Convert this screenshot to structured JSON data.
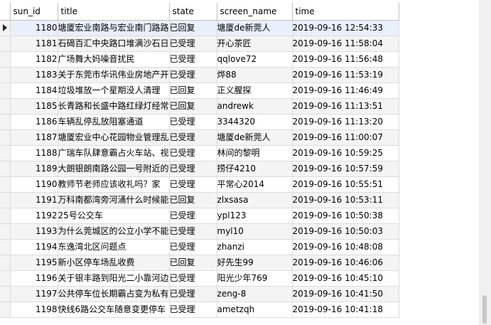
{
  "columns": [
    "sun_id",
    "title",
    "state",
    "screen_name",
    "time"
  ],
  "rows": [
    {
      "sun_id": "1180",
      "title": "塘厦宏业南路与宏业南门路路",
      "state": "已回复",
      "screen_name": "塘厦de新莞人",
      "time": "2019-09-16 12:54:33"
    },
    {
      "sun_id": "1181",
      "title": "石碣百汇中央路口堆满沙石日",
      "state": "已受理",
      "screen_name": "开心茶匠",
      "time": "2019-09-16 11:58:04"
    },
    {
      "sun_id": "1182",
      "title": "广场舞大妈噪音扰民",
      "state": "已受理",
      "screen_name": "qqlove72",
      "time": "2019-09-16 11:56:48"
    },
    {
      "sun_id": "1183",
      "title": "关于东莞市华讯伟业房地产开",
      "state": "已受理",
      "screen_name": "烨88",
      "time": "2019-09-16 11:53:19"
    },
    {
      "sun_id": "1184",
      "title": "垃圾堆放一个星期没人清理",
      "state": "已回复",
      "screen_name": "正义腥探",
      "time": "2019-09-16 11:46:49"
    },
    {
      "sun_id": "1185",
      "title": "长青路和长盛中路红绿灯经常",
      "state": "已回复",
      "screen_name": "andrewk",
      "time": "2019-09-16 11:13:51"
    },
    {
      "sun_id": "1186",
      "title": "车辆乱停乱放阻塞通道",
      "state": "已受理",
      "screen_name": "3344320",
      "time": "2019-09-16 11:13:20"
    },
    {
      "sun_id": "1187",
      "title": "塘厦宏业中心花园物业管理乱",
      "state": "已受理",
      "screen_name": "塘厦de新莞人",
      "time": "2019-09-16 11:00:07"
    },
    {
      "sun_id": "1188",
      "title": "广瑞车队肆意霸占火车站、视",
      "state": "已受理",
      "screen_name": "林间的黎明",
      "time": "2019-09-16 10:59:25"
    },
    {
      "sun_id": "1189",
      "title": "大朗银朗南路公园一号附近的",
      "state": "已受理",
      "screen_name": "捞仔4210",
      "time": "2019-09-16 10:57:59"
    },
    {
      "sun_id": "1190",
      "title": "教师节老师应该收礼吗？家",
      "state": "已受理",
      "screen_name": "平常心2014",
      "time": "2019-09-16 10:55:51"
    },
    {
      "sun_id": "1191",
      "title": "万科南都湾旁河涌什么时候能",
      "state": "已回复",
      "screen_name": "zlxsasa",
      "time": "2019-09-16 10:53:11"
    },
    {
      "sun_id": "1192",
      "title": "25号公交车",
      "state": "已受理",
      "screen_name": "ypl123",
      "time": "2019-09-16 10:50:38"
    },
    {
      "sun_id": "1193",
      "title": "为什么莞城区的公立小学不能",
      "state": "已受理",
      "screen_name": "myl10",
      "time": "2019-09-16 10:50:03"
    },
    {
      "sun_id": "1194",
      "title": "东逸湾北区问题点",
      "state": "已受理",
      "screen_name": "zhanzi",
      "time": "2019-09-16 10:48:08"
    },
    {
      "sun_id": "1195",
      "title": "新小区停车场乱收费",
      "state": "已回复",
      "screen_name": "好先生99",
      "time": "2019-09-16 10:46:06"
    },
    {
      "sun_id": "1196",
      "title": "关于银丰路到阳光二小靠河边",
      "state": "已受理",
      "screen_name": "阳光少年769",
      "time": "2019-09-16 10:45:10"
    },
    {
      "sun_id": "1197",
      "title": "公共停车位长期霸占变为私有",
      "state": "已受理",
      "screen_name": "zeng-8",
      "time": "2019-09-16 10:41:50"
    },
    {
      "sun_id": "1198",
      "title": "快线6路公交车随意变更停车",
      "state": "已受理",
      "screen_name": "ametzqh",
      "time": "2019-09-16 10:41:18"
    }
  ],
  "selected_row_index": 0,
  "colors": {
    "selected_row": "#e8f0fb",
    "alt_row": "#f4f4f4",
    "grid_line": "#dcdcdc"
  },
  "icons": {
    "current_row_indicator": "right-triangle-arrow-icon"
  }
}
